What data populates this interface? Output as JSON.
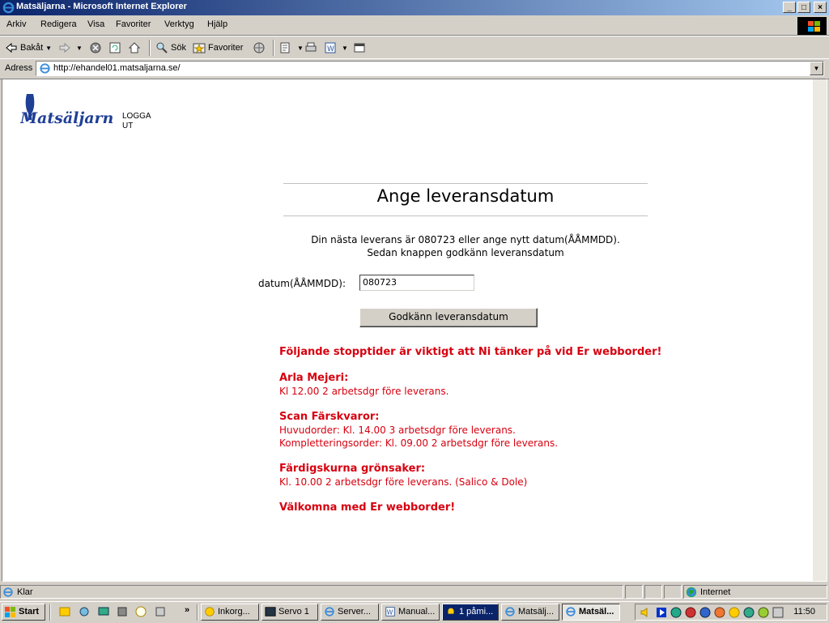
{
  "window": {
    "title": "Matsäljarna - Microsoft Internet Explorer",
    "min_label": "_",
    "max_label": "□",
    "close_label": "×"
  },
  "menu": [
    "Arkiv",
    "Redigera",
    "Visa",
    "Favoriter",
    "Verktyg",
    "Hjälp"
  ],
  "toolbar": {
    "back": "Bakåt",
    "search": "Sök",
    "favorites": "Favoriter"
  },
  "address": {
    "label": "Adress",
    "url": "http://ehandel01.matsaljarna.se/"
  },
  "page": {
    "logo_text": "Matsäljarna",
    "logout": "LOGGA UT",
    "heading": "Ange leveransdatum",
    "info_line1": "Din nästa leverans är 080723 eller ange nytt datum(ÅÅMMDD).",
    "info_line2": "Sedan knappen godkänn leveransdatum",
    "date_label": "datum(ÅÅMMDD):",
    "date_value": "080723",
    "submit_label": "Godkänn leveransdatum",
    "notes": {
      "intro": "Följande stopptider är viktigt att Ni tänker på vid Er webborder!",
      "arla_title": "Arla Mejeri:",
      "arla_1": "Kl 12.00 2 arbetsdgr före leverans.",
      "scan_title": "Scan Färskvaror:",
      "scan_1": "Huvudorder: Kl. 14.00 3 arbetsdgr före leverans.",
      "scan_2": "Kompletteringsorder: Kl. 09.00 2 arbetsdgr före leverans.",
      "veg_title": "Färdigskurna grönsaker:",
      "veg_1": "Kl. 10.00 2 arbetsdgr före leverans. (Salico & Dole)",
      "outro": "Välkomna med Er webborder!"
    }
  },
  "status": {
    "left": "Klar",
    "zone": "Internet"
  },
  "taskbar": {
    "start": "Start",
    "tasks": [
      "Inkorg...",
      "Servo 1",
      "Server...",
      "Manual...",
      "1 påmi...",
      "Matsälj...",
      "Matsäl..."
    ],
    "clock": "11:50",
    "more": "»"
  },
  "colors": {
    "accent_red": "#d7000f",
    "logo_blue": "#1f3f95",
    "titlebar": "#0a246a"
  }
}
